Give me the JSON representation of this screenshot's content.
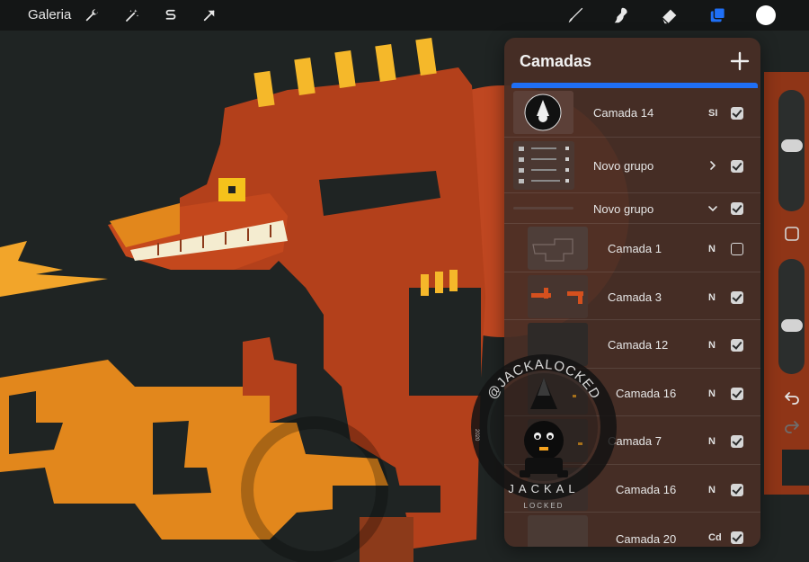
{
  "toolbar": {
    "gallery_label": "Galeria",
    "icons": [
      "wrench-icon",
      "magic-wand-icon",
      "selection-s-icon",
      "transform-arrow-icon",
      "brush-icon",
      "smudge-icon",
      "eraser-icon",
      "layers-icon",
      "color-swatch"
    ],
    "active_tool": "layers",
    "current_color": "#ffffff",
    "accent_color": "#1f6ff5"
  },
  "layers_panel": {
    "title": "Camadas",
    "add_icon": "plus-icon",
    "layers": [
      {
        "name": "Camada 14",
        "blend": "SI",
        "visible": true,
        "kind": "layer"
      },
      {
        "name": "Novo grupo",
        "blend": "",
        "visible": true,
        "kind": "group-collapsed"
      },
      {
        "name": "Novo grupo",
        "blend": "",
        "visible": true,
        "kind": "group-expanded"
      },
      {
        "name": "Camada 1",
        "blend": "N",
        "visible": false,
        "kind": "layer"
      },
      {
        "name": "Camada 3",
        "blend": "N",
        "visible": true,
        "kind": "layer"
      },
      {
        "name": "Camada 12",
        "blend": "N",
        "visible": true,
        "kind": "layer"
      },
      {
        "name": "Camada 16",
        "blend": "N",
        "visible": true,
        "kind": "layer"
      },
      {
        "name": "Camada 7",
        "blend": "N",
        "visible": true,
        "kind": "layer"
      },
      {
        "name": "Camada 16",
        "blend": "N",
        "visible": true,
        "kind": "layer"
      },
      {
        "name": "Camada 20",
        "blend": "Cd",
        "visible": true,
        "kind": "layer"
      }
    ]
  },
  "sidebar": {
    "brush_size_level": 0.5,
    "opacity_level": 0.6,
    "icons": [
      "size-slider",
      "modify-square-icon",
      "opacity-slider",
      "undo-icon",
      "redo-icon"
    ]
  },
  "watermark": {
    "text_top": "@JACKALOCKED",
    "text_bottom": "JACKAL",
    "text_sub": "LOCKED",
    "year": "2020"
  },
  "artwork_colors": {
    "background": "#1f2423",
    "body": "#b5411b",
    "spikes": "#f5b82a",
    "orange": "#e6891e",
    "eye": "#f7c21b",
    "teeth": "#f4ecd0"
  }
}
